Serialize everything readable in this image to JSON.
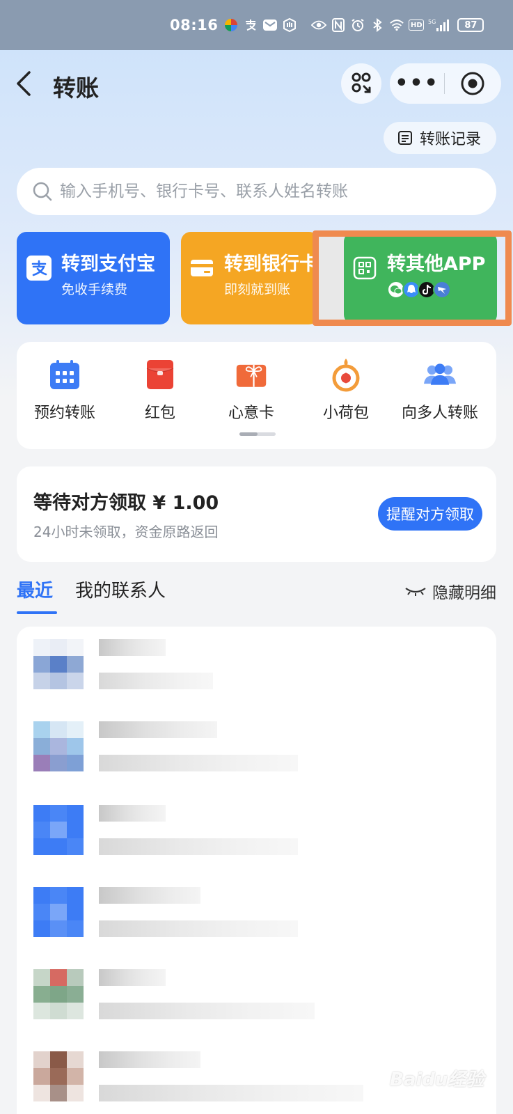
{
  "status_bar": {
    "time": "08:16",
    "network": "5G",
    "battery": "87"
  },
  "header": {
    "title": "转账",
    "more_label": "•••"
  },
  "record_button": {
    "label": "转账记录"
  },
  "search": {
    "placeholder": "输入手机号、银行卡号、联系人姓名转账"
  },
  "cards": [
    {
      "title": "转到支付宝",
      "subtitle": "免收手续费",
      "color": "#2f73f6"
    },
    {
      "title": "转到银行卡",
      "subtitle": "即刻就到账",
      "color": "#f5a623"
    },
    {
      "title": "转其他APP",
      "subtitle": "",
      "color": "#40b55c"
    }
  ],
  "shortcuts": [
    {
      "label": "预约转账",
      "icon": "calendar-icon"
    },
    {
      "label": "红包",
      "icon": "red-envelope-icon"
    },
    {
      "label": "心意卡",
      "icon": "gift-card-icon"
    },
    {
      "label": "小荷包",
      "icon": "lotus-pouch-icon"
    },
    {
      "label": "向多人转账",
      "icon": "group-icon"
    }
  ],
  "pending": {
    "title": "等待对方领取 ¥ 1.00",
    "subtitle": "24小时未领取，资金原路返回",
    "remind_label": "提醒对方领取"
  },
  "tabs": [
    {
      "label": "最近",
      "active": true
    },
    {
      "label": "我的联系人",
      "active": false
    }
  ],
  "hide_detail_label": "隐藏明细",
  "watermark": "Baidu经验",
  "colors": {
    "primary": "#2f73f6",
    "highlight": "#ef8a4f"
  }
}
